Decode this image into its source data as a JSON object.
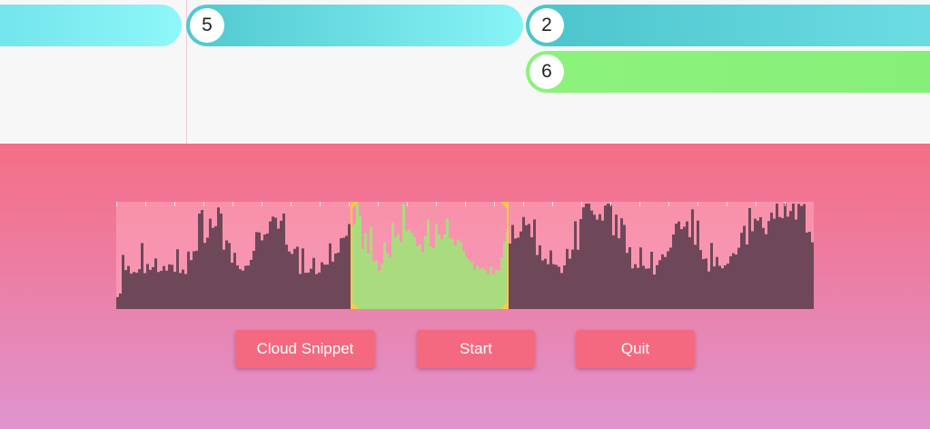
{
  "timeline": {
    "clips": [
      {
        "id": "clip-left",
        "badge": ""
      },
      {
        "id": "clip-5",
        "badge": "5"
      },
      {
        "id": "clip-2",
        "badge": "2"
      },
      {
        "id": "clip-6",
        "badge": "6"
      }
    ]
  },
  "colors": {
    "clip_cyan": "#5fd6dd",
    "clip_green": "#8cf27c",
    "panel_top": "#f56e86",
    "panel_bottom": "#df94cf",
    "waveform_fill": "#6e4858",
    "selection_fill": "#a9dc7e",
    "selection_border": "#ffc94a",
    "button_fill": "#f4697f"
  },
  "waveform": {
    "selection_start_fraction": 0.336,
    "selection_end_fraction": 0.563
  },
  "buttons": {
    "cloud_snippet": "Cloud Snippet",
    "start": "Start",
    "quit": "Quit"
  }
}
